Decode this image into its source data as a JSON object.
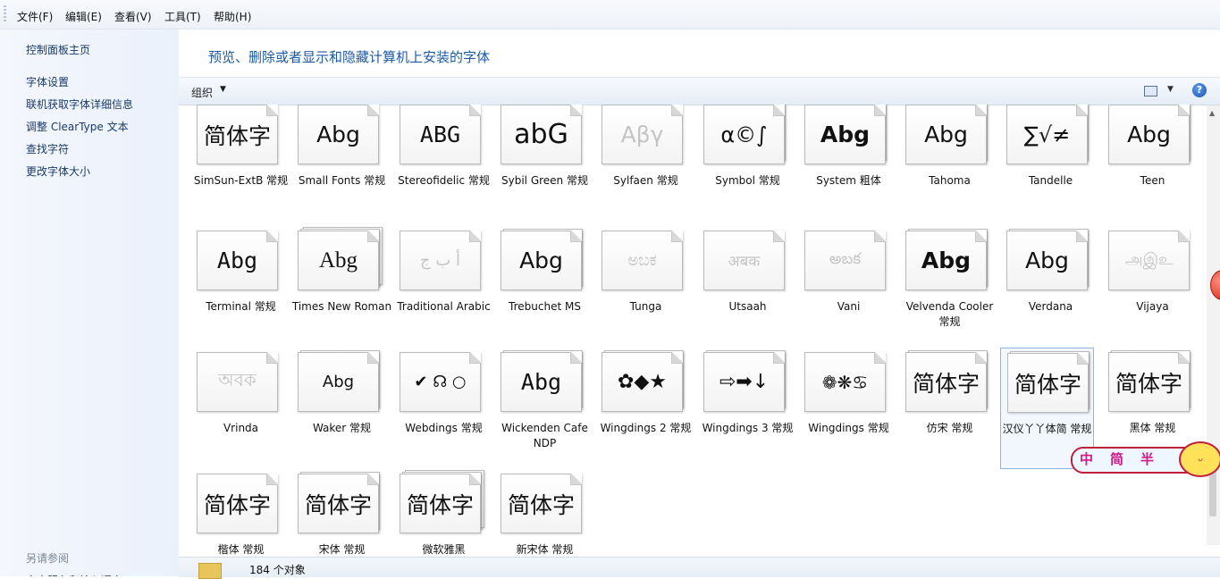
{
  "menu": [
    "文件(F)",
    "编辑(E)",
    "查看(V)",
    "工具(T)",
    "帮助(H)"
  ],
  "sidebar": {
    "home": "控制面板主页",
    "links": [
      "字体设置",
      "联机获取字体详细信息",
      "调整 ClearType 文本",
      "查找字符",
      "更改字体大小"
    ],
    "see_also": "另请参阅",
    "partial": "文本服务和输入语言"
  },
  "heading": "预览、删除或者显示和隐藏计算机上安装的字体",
  "toolbar": {
    "organize": "组织",
    "organize_caret": "▼",
    "view_caret": "▼",
    "help": "?"
  },
  "fonts": [
    {
      "sample": "简体字",
      "name": "SimSun-ExtB 常规"
    },
    {
      "sample": "Abg",
      "name": "Small Fonts 常规"
    },
    {
      "sample": "ABG",
      "name": "Stereofidelic 常规"
    },
    {
      "sample": "abG",
      "name": "Sybil Green 常规"
    },
    {
      "sample": "Αβγ",
      "name": "Sylfaen 常规"
    },
    {
      "sample": "α©∫",
      "name": "Symbol 常规"
    },
    {
      "sample": "Abg",
      "name": "System 粗体"
    },
    {
      "sample": "Abg",
      "name": "Tahoma"
    },
    {
      "sample": "∑√≠",
      "name": "Tandelle"
    },
    {
      "sample": "Abg",
      "name": "Teen"
    },
    {
      "sample": "Abg",
      "name": "Terminal 常规"
    },
    {
      "sample": "Abg",
      "name": "Times New Roman"
    },
    {
      "sample": "أ ب ج",
      "name": "Traditional Arabic"
    },
    {
      "sample": "Abg",
      "name": "Trebuchet MS"
    },
    {
      "sample": "ಅಬಕ",
      "name": "Tunga"
    },
    {
      "sample": "अबक",
      "name": "Utsaah"
    },
    {
      "sample": "అబక",
      "name": "Vani"
    },
    {
      "sample": "Abg",
      "name": "Velvenda Cooler 常规"
    },
    {
      "sample": "Abg",
      "name": "Verdana"
    },
    {
      "sample": "அஇஉ",
      "name": "Vijaya"
    },
    {
      "sample": "অবক",
      "name": "Vrinda"
    },
    {
      "sample": "Abg",
      "name": "Waker 常规"
    },
    {
      "sample": "✔ ☊ ○",
      "name": "Webdings 常规"
    },
    {
      "sample": "Abg",
      "name": "Wickenden Cafe NDP"
    },
    {
      "sample": "✿◆★",
      "name": "Wingdings 2 常规"
    },
    {
      "sample": "⇨➡↓",
      "name": "Wingdings 3 常规"
    },
    {
      "sample": "❁❋♋",
      "name": "Wingdings 常规"
    },
    {
      "sample": "简体字",
      "name": "仿宋 常规"
    },
    {
      "sample": "简体字",
      "name": "汉仪丫丫体简 常规"
    },
    {
      "sample": "简体字",
      "name": "黑体 常规"
    },
    {
      "sample": "简体字",
      "name": "楷体 常规"
    },
    {
      "sample": "简体字",
      "name": "宋体 常规"
    },
    {
      "sample": "简体字",
      "name": "微软雅黑"
    },
    {
      "sample": "简体字",
      "name": "新宋体 常规"
    }
  ],
  "status": {
    "count": "184 个对象"
  },
  "ime": {
    "chars": [
      "中",
      "简",
      "半"
    ],
    "face": "ᴗ"
  }
}
